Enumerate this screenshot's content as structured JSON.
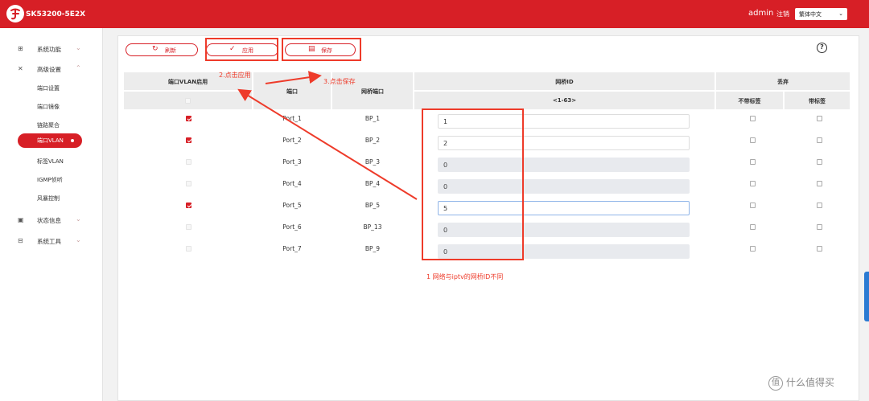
{
  "header": {
    "model": "SK53200-5E2X",
    "username": "admin",
    "logout_label": "注销",
    "language": "繁体中文"
  },
  "sidebar": {
    "groups": [
      {
        "label": "系统功能",
        "icon": "grid-icon"
      },
      {
        "label": "高级设置",
        "icon": "tools-icon"
      },
      {
        "label": "状态信息",
        "icon": "monitor-icon"
      },
      {
        "label": "系统工具",
        "icon": "toolbox-icon"
      }
    ],
    "advanced_items": [
      "端口设置",
      "端口镜像",
      "链路聚合",
      "端口VLAN",
      "标签VLAN",
      "IGMP侦听",
      "风暴控制"
    ],
    "active_item": "端口VLAN"
  },
  "toolbar": {
    "refresh_label": "刷新",
    "apply_label": "应用",
    "save_label": "保存",
    "help_label": "?"
  },
  "table": {
    "headers": {
      "enable": "端口VLAN启用",
      "port": "端口",
      "bridge_port": "网桥端口",
      "bridge_id": "网桥ID",
      "bridge_id_range": "<1-63>",
      "discard": "丢弃",
      "untagged": "不带标签",
      "tagged": "带标签"
    },
    "rows": [
      {
        "enabled": true,
        "port": "Port_1",
        "bridge_port": "BP_1",
        "bridge_id": "1",
        "editable": true
      },
      {
        "enabled": true,
        "port": "Port_2",
        "bridge_port": "BP_2",
        "bridge_id": "2",
        "editable": true
      },
      {
        "enabled": false,
        "port": "Port_3",
        "bridge_port": "BP_3",
        "bridge_id": "0",
        "editable": false
      },
      {
        "enabled": false,
        "port": "Port_4",
        "bridge_port": "BP_4",
        "bridge_id": "0",
        "editable": false
      },
      {
        "enabled": true,
        "port": "Port_5",
        "bridge_port": "BP_5",
        "bridge_id": "5",
        "editable": true
      },
      {
        "enabled": false,
        "port": "Port_6",
        "bridge_port": "BP_13",
        "bridge_id": "0",
        "editable": false
      },
      {
        "enabled": false,
        "port": "Port_7",
        "bridge_port": "BP_9",
        "bridge_id": "0",
        "editable": false
      }
    ]
  },
  "annotations": {
    "step1": "1 网络与iptv的网桥ID不同",
    "step2": "2.点击应用",
    "step3": "3.点击保存",
    "color": "#ee3b2a"
  },
  "watermark": {
    "icon_char": "值",
    "text": "什么值得买"
  },
  "colors": {
    "brand_red": "#d71f26",
    "header_gray": "#ececec",
    "disabled_input": "#e8eaee"
  }
}
